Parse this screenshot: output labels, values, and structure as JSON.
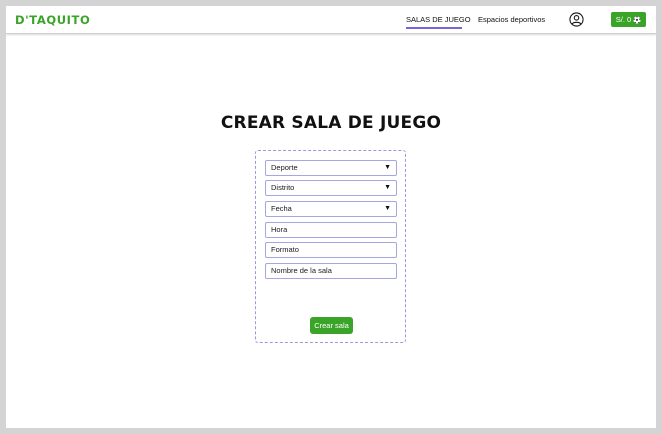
{
  "brand": {
    "logo_text": "D'TAQUITO",
    "accent_color": "#3aa428"
  },
  "nav": {
    "links": [
      {
        "label": "SALAS DE JUEGO",
        "active": true
      },
      {
        "label": "Espacios deportivos",
        "active": false
      }
    ],
    "active_underline_color": "#7b63d9",
    "user_icon": "user-circle-icon",
    "wallet": {
      "label": "S/. 0",
      "icon": "soccer-ball-icon"
    }
  },
  "main": {
    "title": "CREAR SALA DE JUEGO",
    "form": {
      "fields": [
        {
          "placeholder": "Deporte",
          "type": "select"
        },
        {
          "placeholder": "Distrito",
          "type": "select"
        },
        {
          "placeholder": "Fecha",
          "type": "select"
        },
        {
          "placeholder": "Hora",
          "type": "text"
        },
        {
          "placeholder": "Formato",
          "type": "text"
        },
        {
          "placeholder": "Nombre de la sala",
          "type": "text"
        }
      ],
      "submit_label": "Crear sala"
    }
  }
}
